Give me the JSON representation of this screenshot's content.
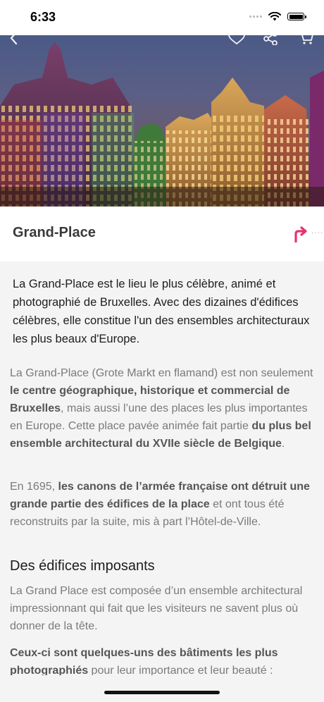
{
  "status": {
    "time": "6:33"
  },
  "hero": {
    "alt_controls": [
      "back-icon",
      "heart-icon",
      "share-icon",
      "cart-icon"
    ]
  },
  "place": {
    "title": "Grand-Place"
  },
  "intro": "La Grand-Place est le lieu le plus célèbre, animé et photographié de Bruxelles. Avec des dizaines d'édifices célèbres, elle constitue l'un des ensembles architecturaux les plus beaux d'Europe.",
  "p1": {
    "a": "La Grand-Place (Grote Markt en flamand) est non seulement ",
    "b": "le centre géographique, historique et commercial de Bruxelles",
    "c": ", mais aussi l’une des places les plus importantes en Europe. Cette place pavée animée fait partie ",
    "d": "du plus bel ensemble architectural du XVIIe siècle de Belgique",
    "e": "."
  },
  "p2": {
    "a": "En 1695, ",
    "b": "les canons de l’armée française ont détruit une grande partie des édifices de la place",
    "c": " et ont tous été reconstruits par la suite, mis à part l’Hôtel-de-Ville."
  },
  "section": {
    "title": "Des édifices imposants"
  },
  "p3": "La Grand Place est composée d’un ensemble architectural impressionnant qui fait que les visiteurs ne savent plus où donner de la tête.",
  "p4": {
    "a": "Ceux-ci sont quelques-uns des bâtiments les plus photographiés",
    "b": " pour leur importance et leur beauté :"
  },
  "colors": {
    "accent": "#e8336d",
    "background": "#f4f4f4"
  }
}
